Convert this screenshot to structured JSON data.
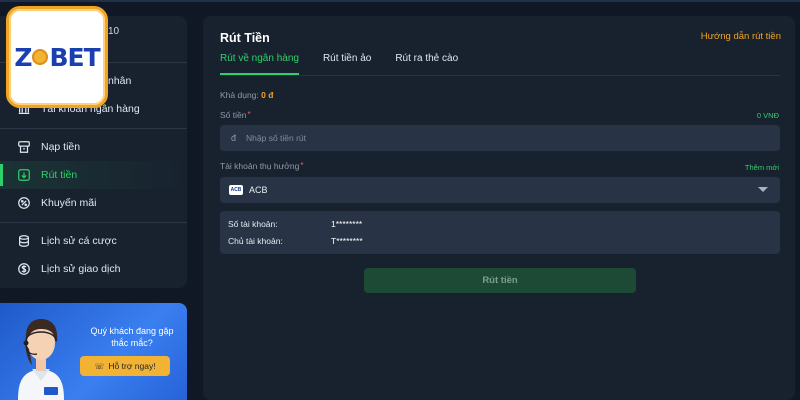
{
  "sidebar": {
    "user_id": "10",
    "items": [
      {
        "label": "nhân",
        "icon": "user-icon"
      },
      {
        "label": "Tài khoản ngân hàng",
        "icon": "bank-icon"
      },
      {
        "label": "Nạp tiền",
        "icon": "atm-icon"
      },
      {
        "label": "Rút tiền",
        "icon": "withdraw-icon"
      },
      {
        "label": "Khuyến mãi",
        "icon": "promo-icon"
      },
      {
        "label": "Lịch sử cá cược",
        "icon": "coins-icon"
      },
      {
        "label": "Lịch sử giao dịch",
        "icon": "dollar-icon"
      }
    ]
  },
  "logo": {
    "text_left": "Z",
    "text_right": "BET"
  },
  "support": {
    "message": "Quý khách đang gặp thắc mắc?",
    "button": "Hỗ trợ ngay!",
    "badge": "Zbet"
  },
  "main": {
    "title": "Rút Tiền",
    "guide_link": "Hướng dẫn rút tiền",
    "tabs": [
      "Rút về ngân hàng",
      "Rút tiền ảo",
      "Rút ra thẻ cào"
    ],
    "available_label": "Khả dụng:",
    "available_value": "0 đ",
    "amount_label": "Số tiền",
    "amount_note": "0 VNĐ",
    "amount_currency": "đ",
    "amount_placeholder": "Nhập số tiền rút",
    "beneficiary_label": "Tài khoản thụ hưởng",
    "add_more": "Thêm mới",
    "bank_logo": "ACB",
    "bank_name": "ACB",
    "account_number_label": "Số tài khoản:",
    "account_number_value": "1********",
    "account_holder_label": "Chủ tài khoản:",
    "account_holder_value": "T********",
    "submit_label": "Rút tiền"
  },
  "colors": {
    "accent_green": "#2fd06a",
    "accent_orange": "#f2a323",
    "panel_bg": "#18222f",
    "page_bg": "#0f1824"
  }
}
